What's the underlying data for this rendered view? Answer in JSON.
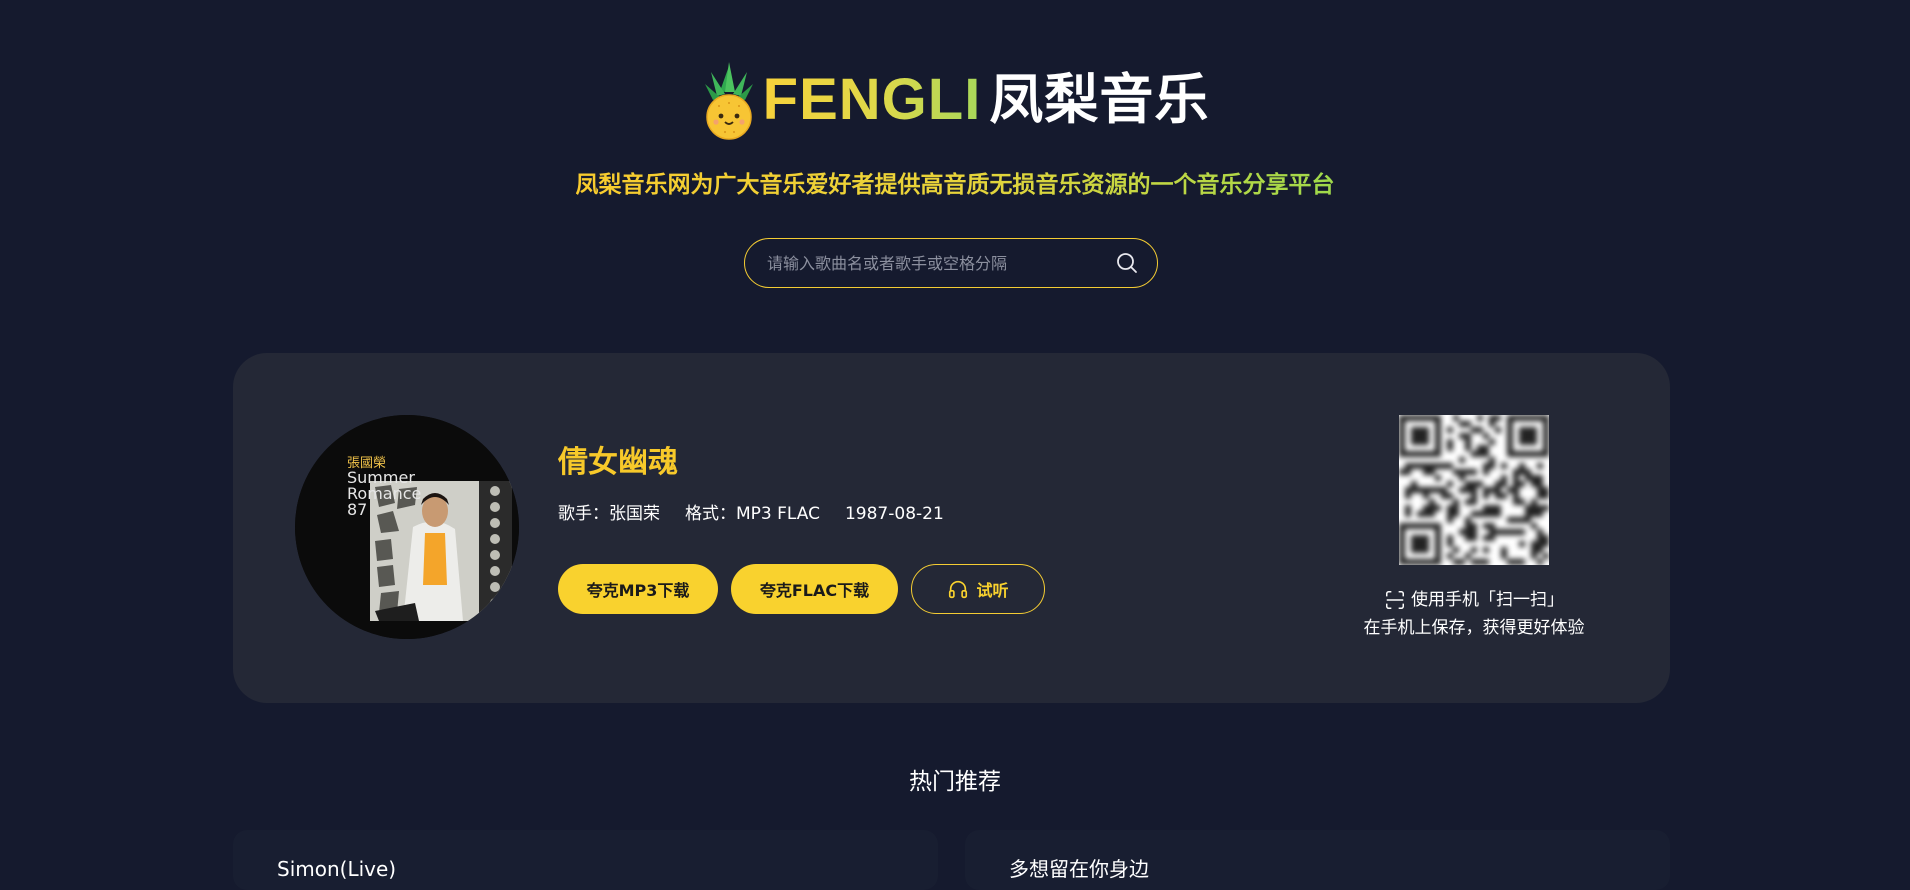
{
  "header": {
    "brand_en": "FENGLI",
    "brand_cn": "凤梨音乐",
    "logo_icon": "pineapple-icon",
    "tagline": "凤梨音乐网为广大音乐爱好者提供高音质无损音乐资源的一个音乐分享平台"
  },
  "search": {
    "placeholder": "请输入歌曲名或者歌手或空格分隔",
    "value": "",
    "icon": "search-icon"
  },
  "song": {
    "title": "倩女幽魂",
    "singer": "歌手：张国荣",
    "format": "格式：MP3 FLAC",
    "date": "1987-08-21",
    "cover_text": {
      "artist": "張國榮",
      "line1": "Summer",
      "line2": "Romance",
      "line3": "87"
    },
    "buttons": {
      "mp3": "夸克MP3下载",
      "flac": "夸克FLAC下载",
      "listen": "试听"
    }
  },
  "qr": {
    "line1": "使用手机「扫一扫」",
    "line2": "在手机上保存，获得更好体验",
    "icon": "scan-icon"
  },
  "recommend": {
    "title": "热门推荐",
    "items": [
      "Simon(Live)",
      "多想留在你身边"
    ]
  },
  "colors": {
    "background": "#151a2e",
    "card": "#242836",
    "accent": "#f9d22e",
    "accent_green": "#9fd94b"
  }
}
